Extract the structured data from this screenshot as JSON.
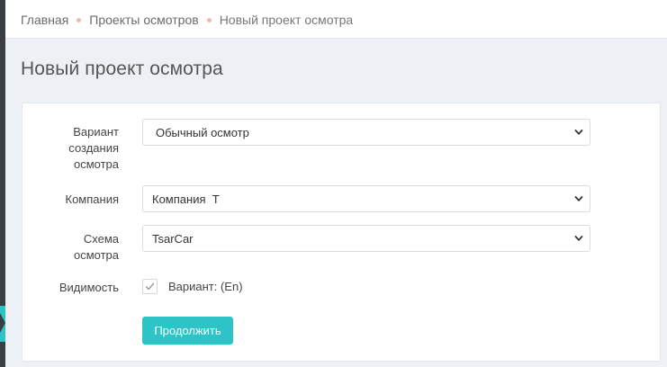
{
  "breadcrumb": {
    "home": "Главная",
    "projects": "Проекты осмотров",
    "current": "Новый проект осмотра"
  },
  "page": {
    "title": "Новый проект осмотра"
  },
  "form": {
    "variant": {
      "label_lines": [
        "Вариант",
        "создания",
        "осмотра"
      ],
      "value": "Обычный осмотр"
    },
    "company": {
      "label": "Компания",
      "value": "Компания  Т"
    },
    "scheme": {
      "label_lines": [
        "Схема",
        "осмотра"
      ],
      "value": "TsarCar"
    },
    "visibility": {
      "label": "Видимость",
      "checkbox_label": "Вариант: (En)",
      "checked": true
    },
    "submit_label": "Продолжить"
  },
  "colors": {
    "accent": "#2ec3c7",
    "breadcrumb_separator": "#f1b8b1",
    "background": "#edf1f5"
  },
  "icons": {
    "select_arrow": "chevron-down-icon",
    "checkbox_mark": "check-icon"
  }
}
